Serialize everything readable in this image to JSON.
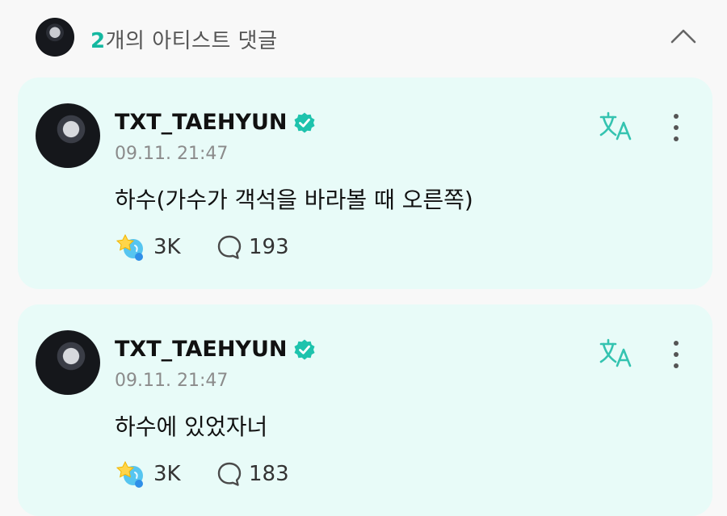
{
  "header": {
    "count": "2",
    "title": "개의 아티스트 댓글"
  },
  "comments": [
    {
      "author": "TXT_TAEHYUN",
      "time": "09.11. 21:47",
      "text": "하수(가수가 객석을 바라볼 때 오른쪽)",
      "cheer_count": "3K",
      "reply_count": "193"
    },
    {
      "author": "TXT_TAEHYUN",
      "time": "09.11. 21:47",
      "text": "하수에 있었자너",
      "cheer_count": "3K",
      "reply_count": "183"
    }
  ],
  "colors": {
    "accent": "#14b8a0",
    "card_bg": "#e8fbf8",
    "verified": "#1ec3ad"
  },
  "icons": {
    "collapse": "chevron-up-icon",
    "translate": "translate-icon",
    "more": "more-vertical-icon",
    "cheer": "cheer-icon",
    "comment": "comment-icon",
    "verified": "verified-badge-icon"
  }
}
